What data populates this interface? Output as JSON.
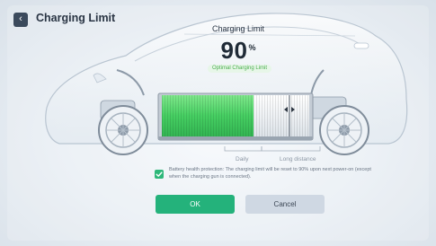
{
  "header": {
    "back_icon": "chevron-left-icon",
    "title": "Charging Limit"
  },
  "limit_panel": {
    "title": "Charging Limit",
    "value": "90",
    "unit": "%",
    "badge": "Optimal Charging Limit",
    "charge_level": 0.9
  },
  "battery": {
    "mode_labels": [
      "Daily",
      "Long distance"
    ],
    "charged_color": "#4cd46a",
    "uncharged_color": "#eef1f4"
  },
  "protection": {
    "checked": true,
    "text": "Battery health protection: The charging limit will be reset to 90% upon next power-on (except when the charging gun is connected)."
  },
  "actions": {
    "ok_label": "OK",
    "cancel_label": "Cancel"
  },
  "colors": {
    "accent_green": "#24b27b",
    "text_dark": "#2a3544"
  }
}
